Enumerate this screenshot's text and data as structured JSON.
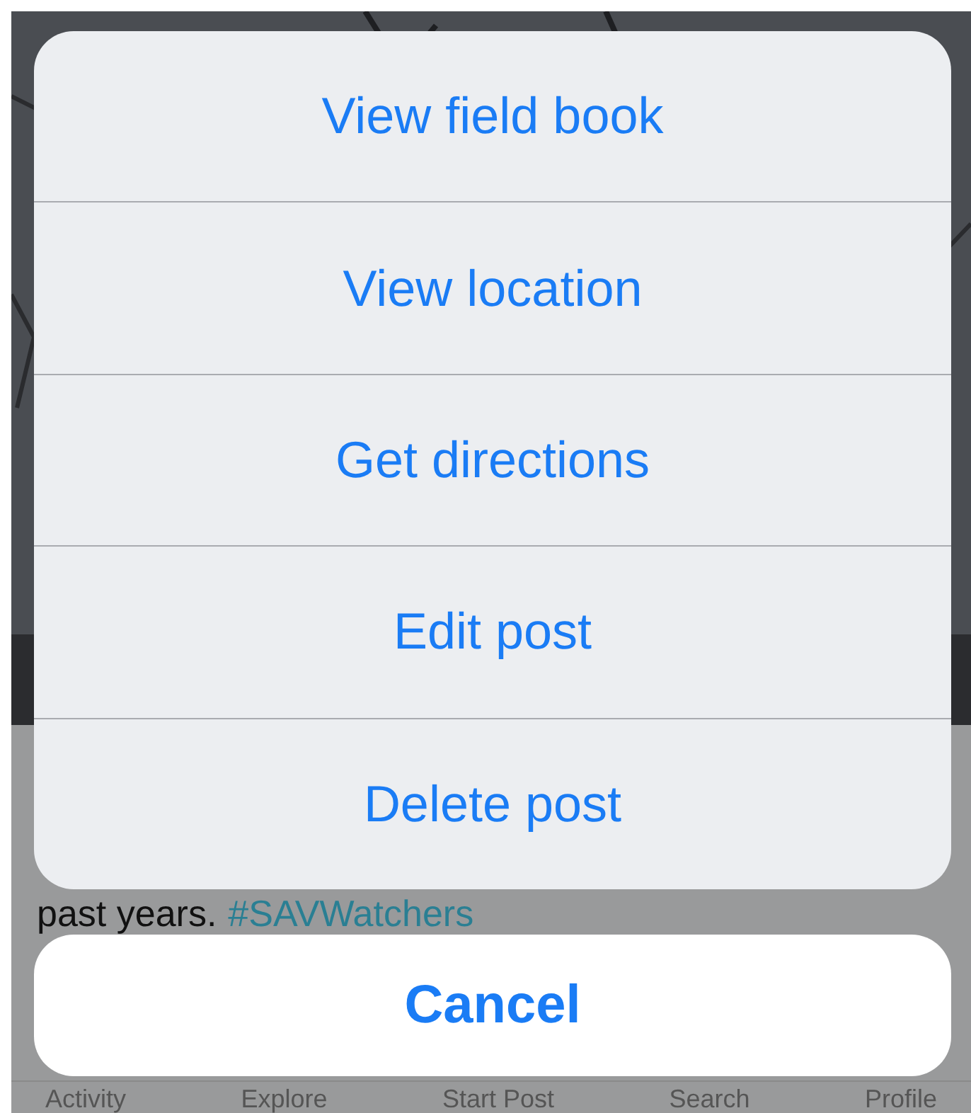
{
  "background": {
    "caption": "past years.",
    "hashtag": "#SAVWatchers",
    "tabs": [
      {
        "label": "Activity"
      },
      {
        "label": "Explore"
      },
      {
        "label": "Start Post"
      },
      {
        "label": "Search"
      },
      {
        "label": "Profile"
      }
    ]
  },
  "action_sheet": {
    "actions": [
      {
        "label": "View field book"
      },
      {
        "label": "View location"
      },
      {
        "label": "Get directions"
      },
      {
        "label": "Edit post"
      },
      {
        "label": "Delete post"
      }
    ],
    "cancel": "Cancel"
  }
}
